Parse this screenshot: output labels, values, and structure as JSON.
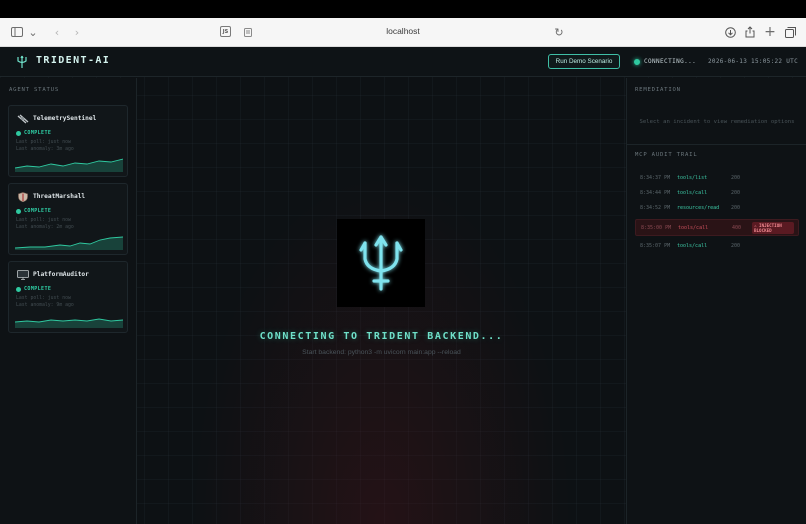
{
  "browser": {
    "url": "localhost",
    "js_badge": "JS"
  },
  "header": {
    "brand": "TRIDENT-AI",
    "run_button": "Run Demo Scenario",
    "connection_status": "CONNECTING...",
    "clock": "2026-06-13 15:05:22 UTC",
    "accent_color": "#2fc9a0"
  },
  "agents": {
    "title": "AGENT STATUS",
    "items": [
      {
        "name": "TelemetrySentinel",
        "icon": "satellite-icon",
        "status": "COMPLETE",
        "last_poll": "Last poll: just now",
        "last_anomaly": "Last anomaly: 3m ago"
      },
      {
        "name": "ThreatMarshall",
        "icon": "shield-icon",
        "status": "COMPLETE",
        "last_poll": "Last poll: just now",
        "last_anomaly": "Last anomaly: 2m ago"
      },
      {
        "name": "PlatformAuditor",
        "icon": "monitor-icon",
        "status": "COMPLETE",
        "last_poll": "Last poll: just now",
        "last_anomaly": "Last anomaly: 9m ago"
      }
    ]
  },
  "center": {
    "connecting": "CONNECTING TO TRIDENT BACKEND...",
    "start_cmd": "Start backend: python3 -m uvicorn main:app --reload"
  },
  "remediation": {
    "title": "REMEDIATION",
    "empty": "Select an incident to view remediation options"
  },
  "audit": {
    "title": "MCP AUDIT TRAIL",
    "rows": [
      {
        "time": "8:34:37 PM",
        "tool": "tools/list",
        "code": "200",
        "blocked": false
      },
      {
        "time": "8:34:44 PM",
        "tool": "tools/call",
        "code": "200",
        "blocked": false
      },
      {
        "time": "8:34:52 PM",
        "tool": "resources/read",
        "code": "200",
        "blocked": false
      },
      {
        "time": "8:35:00 PM",
        "tool": "tools/call",
        "code": "400",
        "blocked": true,
        "badge": "⚠ INJECTION BLOCKED"
      },
      {
        "time": "8:35:07 PM",
        "tool": "tools/call",
        "code": "200",
        "blocked": false
      }
    ]
  }
}
